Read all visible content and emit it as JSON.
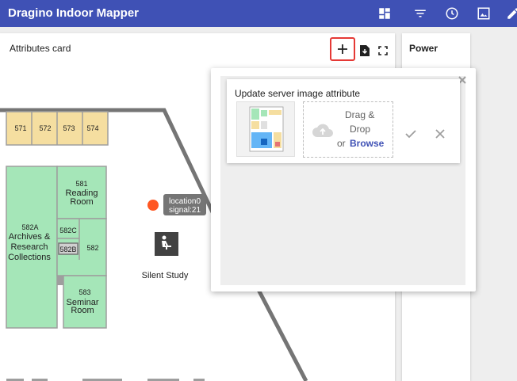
{
  "header": {
    "title": "Dragino Indoor Mapper",
    "icons": [
      "dashboard-icon",
      "filter-icon",
      "history-icon",
      "image-icon",
      "edit-icon"
    ]
  },
  "map_card": {
    "title": "Attributes card",
    "rooms": {
      "r571": "571",
      "r572": "572",
      "r573": "573",
      "r574": "574",
      "r581_num": "581",
      "r581_name1": "Reading",
      "r581_name2": "Room",
      "r582a_num": "582A",
      "r582a_l1": "Archives &",
      "r582a_l2": "Research",
      "r582a_l3": "Collections",
      "r582c": "582C",
      "r582b": "582B",
      "r582": "582",
      "r583_num": "583",
      "r583_l1": "Seminar",
      "r583_l2": "Room"
    },
    "silent_study": "Silent Study",
    "marker_label_1": "location0",
    "marker_label_2": "signal:21"
  },
  "power_card": {
    "title": "Power"
  },
  "upload": {
    "title": "Update server image attribute",
    "drag_line1": "Drag &",
    "drag_line2": "Drop",
    "or": "or",
    "browse": "Browse"
  },
  "colors": {
    "primary": "#3f51b5",
    "marker": "#ff5722",
    "highlight": "#e53935",
    "room_yellow": "#f5deA0",
    "room_green": "#a5e6b8"
  }
}
